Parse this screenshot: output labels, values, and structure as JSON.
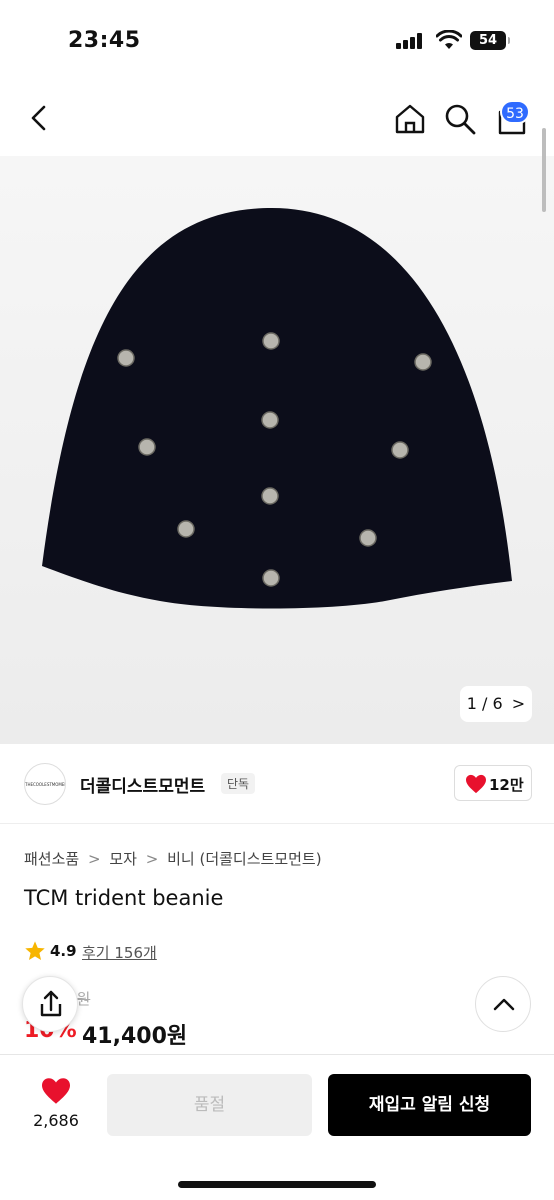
{
  "status_bar": {
    "time": "23:45",
    "battery": "54"
  },
  "header": {
    "cart_count": "53"
  },
  "gallery": {
    "counter": "1 / 6",
    "arrow": ">"
  },
  "brand": {
    "logo_text": "THECOOLESTMOMENT",
    "name": "더콜디스트모먼트",
    "badge": "단독",
    "like_count": "12만"
  },
  "breadcrumb": {
    "items": [
      "패션소품",
      "모자",
      "비니 (더콜디스트모먼트)"
    ],
    "separator": ">"
  },
  "product": {
    "title": "TCM trident beanie",
    "rating": "4.9",
    "review_text": "후기 156개",
    "original_price": "46,000원",
    "discount": "10%",
    "sale_price": "41,400원"
  },
  "bottom_bar": {
    "wish_count": "2,686",
    "soldout_label": "품절",
    "restock_label": "재입고 알림 신청"
  },
  "colors": {
    "accent_red": "#ee1c25",
    "badge_blue": "#2f6bff",
    "primary_button": "#000000"
  }
}
